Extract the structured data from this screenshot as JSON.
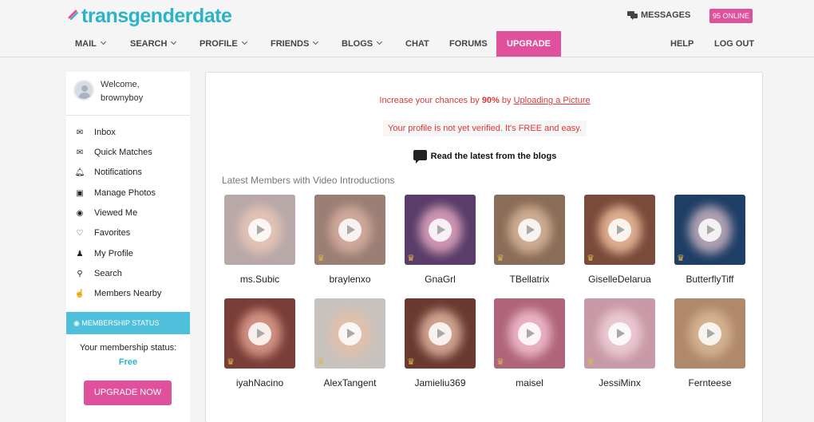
{
  "header": {
    "logo_text": "transgenderdate",
    "messages_label": "MESSAGES",
    "online_badge": "95 ONLINE"
  },
  "nav": {
    "mail": "MAIL",
    "search": "SEARCH",
    "profile": "PROFILE",
    "friends": "FRIENDS",
    "blogs": "BLOGS",
    "chat": "CHAT",
    "forums": "FORUMS",
    "upgrade": "UPGRADE",
    "help": "HELP",
    "logout": "LOG OUT"
  },
  "sidebar": {
    "welcome": "Welcome,",
    "username": "brownyboy",
    "items": [
      {
        "label": "Inbox",
        "icon": "envelope-icon"
      },
      {
        "label": "Quick Matches",
        "icon": "envelope-icon"
      },
      {
        "label": "Notifications",
        "icon": "bell-icon"
      },
      {
        "label": "Manage Photos",
        "icon": "camera-icon"
      },
      {
        "label": "Viewed Me",
        "icon": "eye-icon"
      },
      {
        "label": "Favorites",
        "icon": "heart-icon"
      },
      {
        "label": "My Profile",
        "icon": "user-icon"
      },
      {
        "label": "Search",
        "icon": "search-icon"
      },
      {
        "label": "Members Nearby",
        "icon": "hand-icon"
      }
    ],
    "membership_header": "MEMBERSHIP STATUS",
    "membership_label": "Your membership status:",
    "membership_value": "Free",
    "upgrade_button": "UPGRADE NOW"
  },
  "main": {
    "notice1_pre": "Increase your chances by",
    "notice1_percent": "90%",
    "notice1_by": "by",
    "notice1_link": "Uploading a Picture",
    "notice2": "Your profile is not yet verified. It's FREE and easy.",
    "blogs_link": "Read the latest from the blogs",
    "section_title": "Latest Members with Video Introductions",
    "members": [
      {
        "name": "ms.Subic",
        "bg": "#b9a8a8",
        "tone": "#e8c7b8",
        "crown": false
      },
      {
        "name": "braylenxo",
        "bg": "#9b7e74",
        "tone": "#d8b0a0",
        "crown": true
      },
      {
        "name": "GnaGrl",
        "bg": "#5a3d6a",
        "tone": "#e3a7c0",
        "crown": true
      },
      {
        "name": "TBellatrix",
        "bg": "#8a6d58",
        "tone": "#d9b79b",
        "crown": true
      },
      {
        "name": "GiselleDelarua",
        "bg": "#7a4a3a",
        "tone": "#f0c0a0",
        "crown": true
      },
      {
        "name": "ButterflyTiff",
        "bg": "#1f3f66",
        "tone": "#c9b2c0",
        "crown": true
      },
      {
        "name": "iyahNacino",
        "bg": "#7a3e38",
        "tone": "#e0a090",
        "crown": true
      },
      {
        "name": "AlexTangent",
        "bg": "#c8c2bf",
        "tone": "#e3c0a8",
        "crown": true
      },
      {
        "name": "Jamieliu369",
        "bg": "#6a3a30",
        "tone": "#e0b4a0",
        "crown": true
      },
      {
        "name": "maisel",
        "bg": "#b0647a",
        "tone": "#f2c0cf",
        "crown": true
      },
      {
        "name": "JessiMinx",
        "bg": "#c89aa8",
        "tone": "#f0d0d8",
        "crown": true
      },
      {
        "name": "Fernteese",
        "bg": "#b0896a",
        "tone": "#d8b898",
        "crown": false
      }
    ]
  },
  "colors": {
    "accent_pink": "#e0509d",
    "accent_teal": "#2bb3c8",
    "alert_red": "#d93a3a"
  }
}
